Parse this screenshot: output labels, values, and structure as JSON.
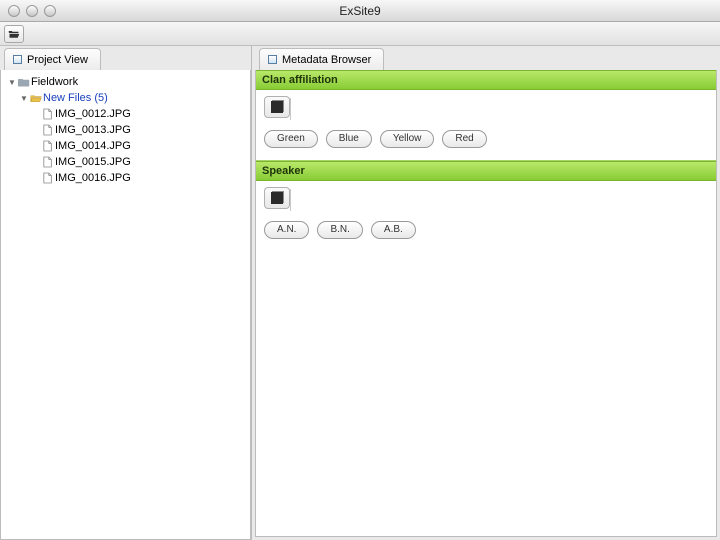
{
  "window": {
    "title": "ExSite9"
  },
  "left": {
    "tab_label": "Project View",
    "tree": {
      "root": {
        "label": "Fieldwork"
      },
      "folder": {
        "label": "New Files",
        "count_suffix": "(5)"
      },
      "files": [
        "IMG_0012.JPG",
        "IMG_0013.JPG",
        "IMG_0014.JPG",
        "IMG_0015.JPG",
        "IMG_0016.JPG"
      ]
    }
  },
  "right": {
    "tab_label": "Metadata Browser",
    "sections": [
      {
        "title": "Clan affiliation",
        "options": [
          "Green",
          "Blue",
          "Yellow",
          "Red"
        ]
      },
      {
        "title": "Speaker",
        "options": [
          "A.N.",
          "B.N.",
          "A.B."
        ]
      }
    ]
  }
}
